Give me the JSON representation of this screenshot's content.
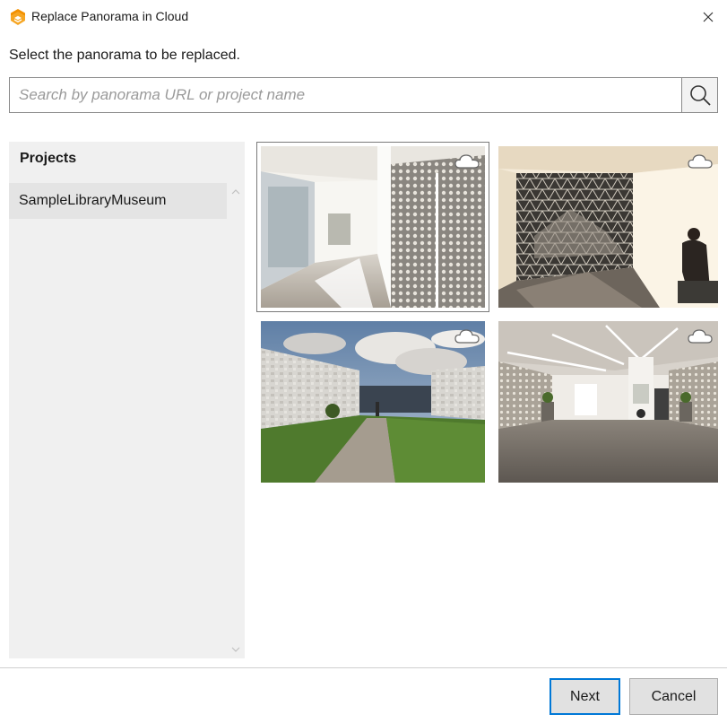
{
  "window": {
    "title": "Replace Panorama in Cloud",
    "app_icon": "enscape-logo-icon",
    "close_icon": "close-icon"
  },
  "instruction": "Select the panorama to be replaced.",
  "search": {
    "placeholder": "Search by panorama URL or project name",
    "value": "",
    "icon": "search-icon"
  },
  "projects": {
    "header": "Projects",
    "items": [
      {
        "label": "SampleLibraryMuseum",
        "selected": true
      }
    ]
  },
  "panoramas": [
    {
      "scene": "white-corridor-perforated-screen",
      "cloud_icon": "cloud-icon",
      "selected": true
    },
    {
      "scene": "atrium-geodesic-sculpture-person",
      "cloud_icon": "cloud-icon",
      "selected": false
    },
    {
      "scene": "exterior-museum-gravel-path",
      "cloud_icon": "cloud-icon",
      "selected": false
    },
    {
      "scene": "gallery-hall-exhibit-panels",
      "cloud_icon": "cloud-icon",
      "selected": false
    }
  ],
  "buttons": {
    "next": "Next",
    "cancel": "Cancel"
  },
  "colors": {
    "accent": "#0078d7",
    "brand": "#f29100",
    "panel_bg": "#f0f0f0",
    "selected_item_bg": "#e4e4e4"
  }
}
